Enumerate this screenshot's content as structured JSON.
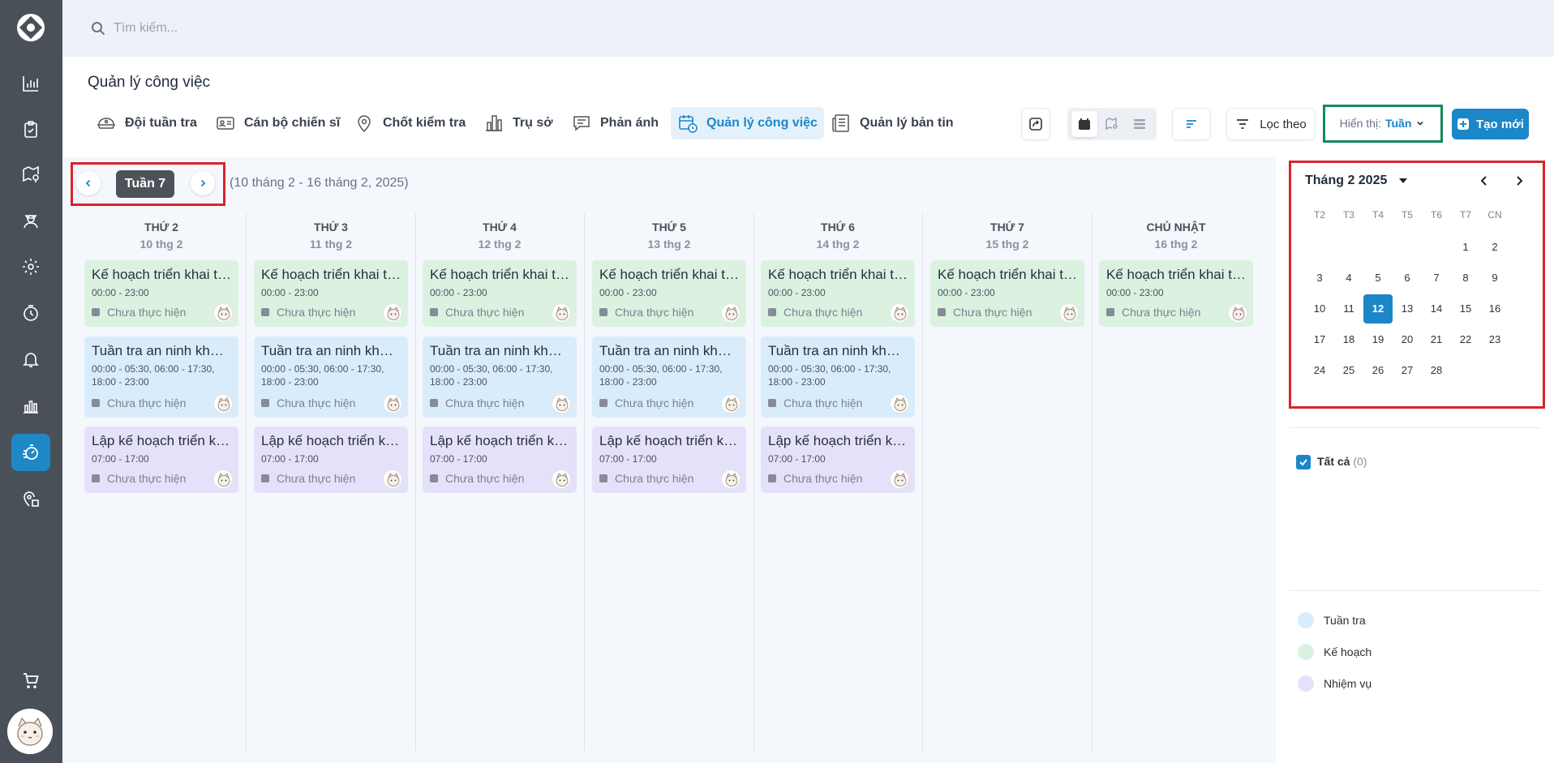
{
  "search": {
    "placeholder": "Tìm kiếm..."
  },
  "page": {
    "title": "Quản lý công việc"
  },
  "tabs": [
    {
      "label": "Đội tuần tra",
      "icon": "police-cap-icon"
    },
    {
      "label": "Cán bộ chiến sĩ",
      "icon": "id-card-icon"
    },
    {
      "label": "Chốt kiểm tra",
      "icon": "location-pin-icon"
    },
    {
      "label": "Trụ sở",
      "icon": "building-icon"
    },
    {
      "label": "Phản ánh",
      "icon": "chat-icon"
    },
    {
      "label": "Quản lý công việc",
      "icon": "calendar-clock-icon",
      "active": true
    },
    {
      "label": "Quản lý bản tin",
      "icon": "newspaper-icon"
    }
  ],
  "toolbar": {
    "filter_label": "Lọc theo",
    "display_prefix": "Hiển thị:",
    "display_value": "Tuần",
    "create_label": "Tạo mới"
  },
  "week": {
    "label": "Tuần 7",
    "range": "(10 tháng 2 - 16 tháng 2, 2025)"
  },
  "days": [
    {
      "name": "THỨ 2",
      "date": "10 thg 2",
      "events": [
        "plan",
        "patrol",
        "task"
      ]
    },
    {
      "name": "THỨ 3",
      "date": "11 thg 2",
      "events": [
        "plan",
        "patrol",
        "task"
      ]
    },
    {
      "name": "THỨ 4",
      "date": "12 thg 2",
      "events": [
        "plan",
        "patrol",
        "task"
      ]
    },
    {
      "name": "THỨ 5",
      "date": "13 thg 2",
      "events": [
        "plan",
        "patrol",
        "task"
      ]
    },
    {
      "name": "THỨ 6",
      "date": "14 thg 2",
      "events": [
        "plan",
        "patrol",
        "task"
      ]
    },
    {
      "name": "THỨ 7",
      "date": "15 thg 2",
      "events": [
        "plan"
      ]
    },
    {
      "name": "CHỦ NHẬT",
      "date": "16 thg 2",
      "events": [
        "plan"
      ]
    }
  ],
  "event_templates": {
    "plan": {
      "title": "Kế hoạch triển khai tu...",
      "time": "00:00 - 23:00",
      "status": "Chưa thực hiện"
    },
    "patrol": {
      "title": "Tuần tra an ninh khu v...",
      "time": "00:00 - 05:30, 06:00 - 17:30, 18:00 - 23:00",
      "status": "Chưa thực hiện"
    },
    "task": {
      "title": "Lập kế hoạch triển kha...",
      "time": "07:00 - 17:00",
      "status": "Chưa thực hiện"
    }
  },
  "mini_calendar": {
    "title": "Tháng 2 2025",
    "weekdays": [
      "T2",
      "T3",
      "T4",
      "T5",
      "T6",
      "T7",
      "CN"
    ],
    "weeks": [
      [
        "",
        "",
        "",
        "",
        "",
        "1",
        "2"
      ],
      [
        "3",
        "4",
        "5",
        "6",
        "7",
        "8",
        "9"
      ],
      [
        "10",
        "11",
        "12",
        "13",
        "14",
        "15",
        "16"
      ],
      [
        "17",
        "18",
        "19",
        "20",
        "21",
        "22",
        "23"
      ],
      [
        "24",
        "25",
        "26",
        "27",
        "28",
        "",
        ""
      ]
    ],
    "selected": "12"
  },
  "filter": {
    "all_label": "Tất cả",
    "all_count": "(0)"
  },
  "legend": [
    {
      "label": "Tuần tra",
      "color": "#d9ecfb"
    },
    {
      "label": "Kế hoạch",
      "color": "#dbf2e1"
    },
    {
      "label": "Nhiệm vụ",
      "color": "#e5e1fb"
    }
  ],
  "colors": {
    "accent": "#1b87c9",
    "sidebar": "#4a5058",
    "highlight_red": "#d9242c",
    "highlight_green": "#13895a"
  }
}
